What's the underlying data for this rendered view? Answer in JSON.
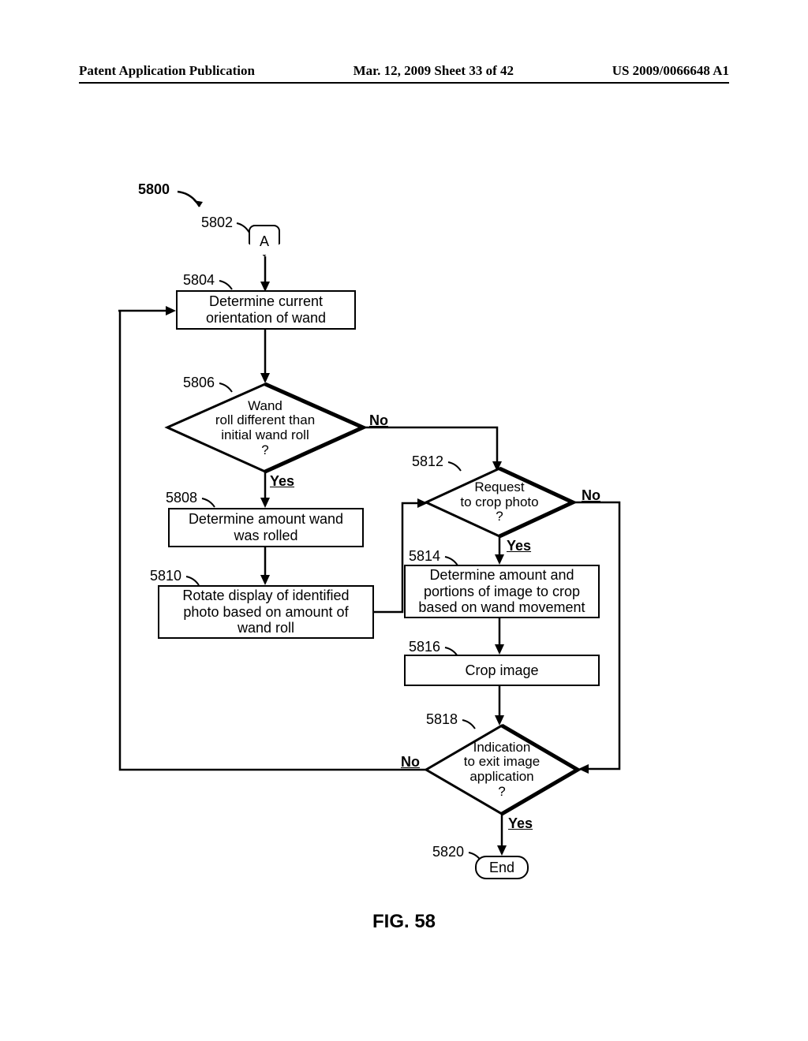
{
  "header": {
    "left": "Patent Application Publication",
    "middle": "Mar. 12, 2009  Sheet 33 of 42",
    "right": "US 2009/0066648 A1"
  },
  "figure_caption": "FIG. 58",
  "refs": {
    "r5800": "5800",
    "r5802": "5802",
    "r5804": "5804",
    "r5806": "5806",
    "r5808": "5808",
    "r5810": "5810",
    "r5812": "5812",
    "r5814": "5814",
    "r5816": "5816",
    "r5818": "5818",
    "r5820": "5820"
  },
  "shapes": {
    "connector_a": "A",
    "box5804": "Determine current\norientation of wand",
    "dec5806": "Wand\nroll different than\ninitial wand roll\n?",
    "box5808": "Determine amount wand\nwas rolled",
    "box5810": "Rotate display of identified\nphoto based on amount of\nwand roll",
    "dec5812": "Request\nto crop photo\n?",
    "box5814": "Determine amount and\nportions of image to crop\nbased on wand movement",
    "box5816": "Crop image",
    "dec5818": "Indication\nto exit image\napplication\n?",
    "end": "End"
  },
  "labels": {
    "yes": "Yes",
    "no": "No"
  },
  "chart_data": {
    "type": "flowchart",
    "title": "FIG. 58",
    "start_ref": "5800",
    "nodes": [
      {
        "id": "5802",
        "type": "connector",
        "text": "A"
      },
      {
        "id": "5804",
        "type": "process",
        "text": "Determine current orientation of wand"
      },
      {
        "id": "5806",
        "type": "decision",
        "text": "Wand roll different than initial wand roll?"
      },
      {
        "id": "5808",
        "type": "process",
        "text": "Determine amount wand was rolled"
      },
      {
        "id": "5810",
        "type": "process",
        "text": "Rotate display of identified photo based on amount of wand roll"
      },
      {
        "id": "5812",
        "type": "decision",
        "text": "Request to crop photo?"
      },
      {
        "id": "5814",
        "type": "process",
        "text": "Determine amount and portions of image to crop based on wand movement"
      },
      {
        "id": "5816",
        "type": "process",
        "text": "Crop image"
      },
      {
        "id": "5818",
        "type": "decision",
        "text": "Indication to exit image application?"
      },
      {
        "id": "5820",
        "type": "terminal",
        "text": "End"
      }
    ],
    "edges": [
      {
        "from": "5802",
        "to": "5804",
        "label": ""
      },
      {
        "from": "5804",
        "to": "5806",
        "label": ""
      },
      {
        "from": "5806",
        "to": "5808",
        "label": "Yes"
      },
      {
        "from": "5806",
        "to": "5812",
        "label": "No"
      },
      {
        "from": "5808",
        "to": "5810",
        "label": ""
      },
      {
        "from": "5810",
        "to": "5812",
        "label": ""
      },
      {
        "from": "5812",
        "to": "5814",
        "label": "Yes"
      },
      {
        "from": "5812",
        "to": "5818",
        "label": "No"
      },
      {
        "from": "5814",
        "to": "5816",
        "label": ""
      },
      {
        "from": "5816",
        "to": "5818",
        "label": ""
      },
      {
        "from": "5818",
        "to": "5804",
        "label": "No"
      },
      {
        "from": "5818",
        "to": "5820",
        "label": "Yes"
      }
    ]
  }
}
